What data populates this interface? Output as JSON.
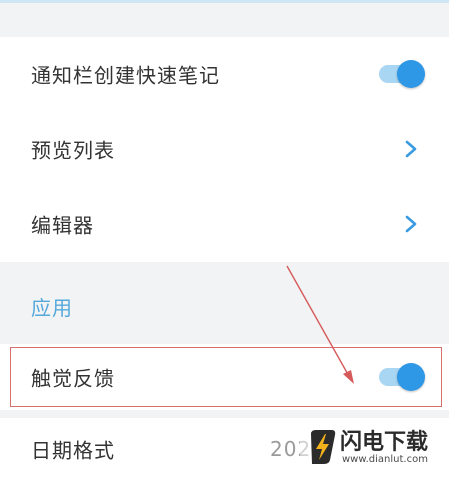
{
  "settings": {
    "notify_quick_note": {
      "label": "通知栏创建快速笔记",
      "enabled": true
    },
    "preview_list": {
      "label": "预览列表"
    },
    "editor": {
      "label": "编辑器"
    },
    "section_app": "应用",
    "haptic_feedback": {
      "label": "触觉反馈",
      "enabled": true
    },
    "date_format": {
      "label": "日期格式",
      "value_visible": "202"
    }
  },
  "watermark": {
    "name": "闪电下载",
    "url": "www.dianlut.com"
  },
  "colors": {
    "accent": "#2e97e6",
    "track": "#a9d6f3",
    "section": "#57a9dc",
    "highlight": "#d76f6f"
  },
  "icons": [
    "chevron-right-icon",
    "toggle-switch",
    "lightning-logo-icon",
    "annotation-arrow"
  ]
}
